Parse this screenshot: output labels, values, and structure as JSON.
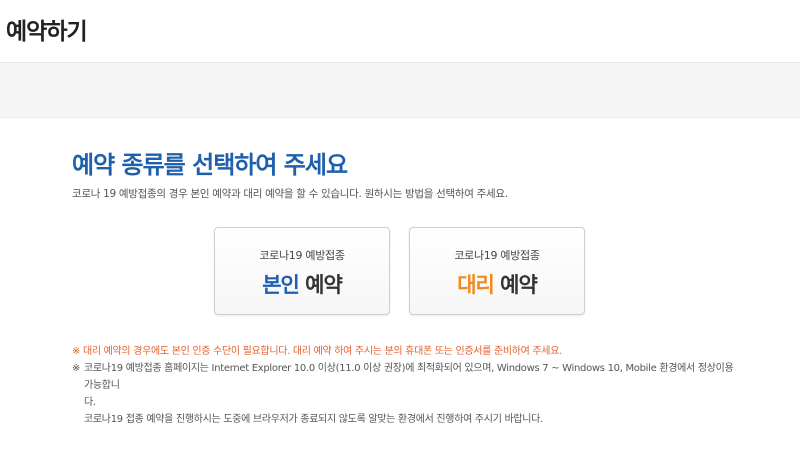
{
  "header": {
    "title": "예약하기"
  },
  "main": {
    "title": "예약 종류를 선택하여 주세요",
    "description": "코로나 19 예방접종의 경우 본인 예약과 대리 예약을 할 수 있습니다. 원하시는 방법을 선택하여 주세요."
  },
  "cards": {
    "self": {
      "subtitle": "코로나19 예방접종",
      "accent": "본인",
      "rest": " 예약"
    },
    "proxy": {
      "subtitle": "코로나19 예방접종",
      "accent": "대리",
      "rest": " 예약"
    }
  },
  "notes": {
    "mark": "※",
    "warning": "※ 대리 예약의 경우에도 본인 인증 수단이 필요합니다. 대리 예약 하여 주시는 분의 휴대폰 또는 인증서를 준비하여 주세요.",
    "browser_line1": "코로나19 예방접종 홈페이지는 Internet Explorer 10.0 이상(11.0 이상 권장)에 최적화되어 있으며, Windows 7 ~ Windows 10, Mobile 환경에서 정상이용 가능합니",
    "browser_line2": "다.",
    "browser_line3": "코로나19 접종 예약을 진행하시는 도중에 브라우저가 종료되지 않도록 알맞는 환경에서 진행하여 주시기 바랍니다."
  },
  "colors": {
    "primary_blue": "#1f5fae",
    "accent_orange": "#f08a1c",
    "warning_red": "#e4612d"
  }
}
